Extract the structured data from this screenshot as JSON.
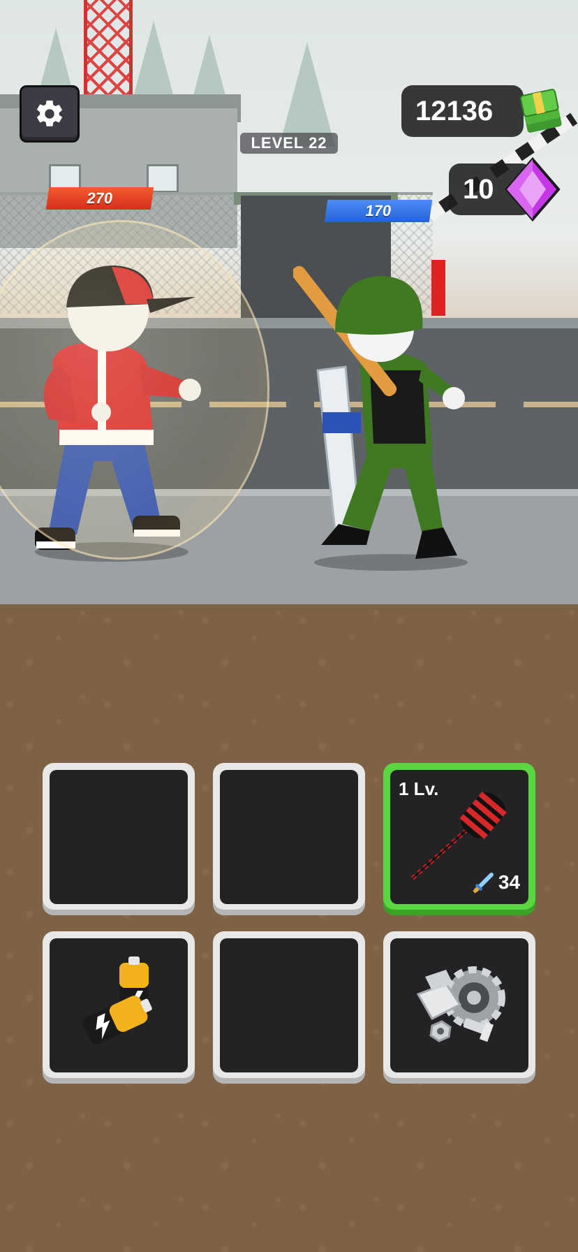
{
  "hud": {
    "level_label": "LEVEL 22",
    "cash": "12136",
    "gems": "10",
    "settings_icon": "gear-icon",
    "cash_icon": "cash-stack-icon",
    "gem_icon": "purple-gem-icon"
  },
  "fighters": {
    "player": {
      "hp": "270",
      "hp_color": "#e0381f"
    },
    "enemy": {
      "hp": "170",
      "hp_color": "#2f6fe0"
    }
  },
  "inventory": {
    "slots": [
      {
        "item": "",
        "icon": ""
      },
      {
        "item": "",
        "icon": ""
      },
      {
        "item": "hammer",
        "icon": "hammer-icon",
        "level": "1 Lv.",
        "damage": "34",
        "damage_icon": "sword-icon",
        "highlighted": true
      },
      {
        "item": "batteries",
        "icon": "battery-icon"
      },
      {
        "item": "",
        "icon": ""
      },
      {
        "item": "scrap",
        "icon": "gear-bolts-icon"
      }
    ]
  },
  "colors": {
    "accent_green": "#5ad640",
    "hp_red": "#e0381f",
    "hp_blue": "#2f6fe0",
    "gem_purple": "#c436e6"
  }
}
